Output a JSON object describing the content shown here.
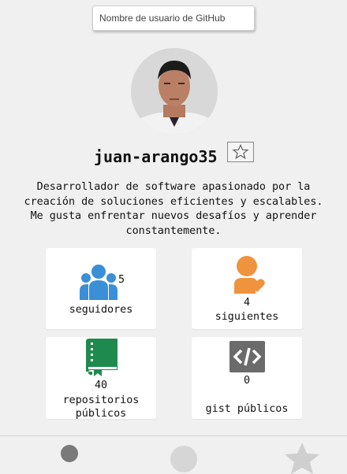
{
  "search": {
    "placeholder": "Nombre de usuario de GitHub"
  },
  "profile": {
    "username": "juan-arango35",
    "bio": "Desarrollador de software apasionado por la creación de soluciones eficientes y escalables. Me gusta enfrentar nuevos desafíos y aprender constantemente."
  },
  "stats": {
    "followers": {
      "count": "5",
      "label": "seguidores",
      "icon": "users-icon",
      "color": "#3a8fd6"
    },
    "following": {
      "count": "4",
      "label": "siguientes",
      "icon": "user-heart-icon",
      "color": "#f0933e"
    },
    "repos": {
      "count": "40",
      "label": "repositorios públicos",
      "icon": "book-icon",
      "color": "#1e8a4e"
    },
    "gists": {
      "count": "0",
      "label": "gist públicos",
      "icon": "code-icon",
      "color": "#6b6b6b"
    }
  },
  "nav": {
    "icons": [
      "circle-icon",
      "circle-icon",
      "star-icon"
    ]
  }
}
